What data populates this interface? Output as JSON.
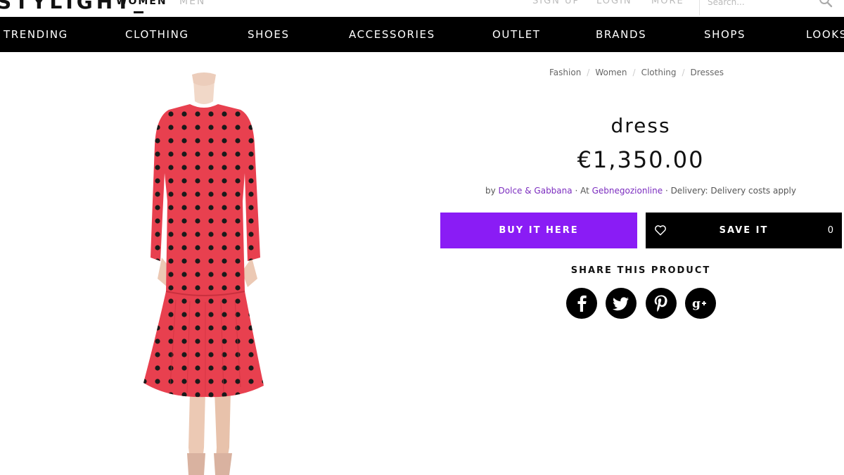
{
  "header": {
    "logo": "STYLIGHT",
    "gender_tabs": [
      "WOMEN",
      "MEN"
    ],
    "links": [
      "SIGN UP",
      "LOGIN",
      "MORE"
    ],
    "search_placeholder": "Search..."
  },
  "nav": {
    "items": [
      "TRENDING",
      "CLOTHING",
      "SHOES",
      "ACCESSORIES",
      "OUTLET",
      "BRANDS",
      "SHOPS",
      "LOOKS"
    ]
  },
  "breadcrumb": [
    "Fashion",
    "Women",
    "Clothing",
    "Dresses"
  ],
  "product": {
    "name": "dress",
    "price": "€1,350.00",
    "by_label": "by",
    "brand": "Dolce & Gabbana",
    "at_label": "· At",
    "shop": "Gebnegozionline",
    "delivery_label": "· Delivery:",
    "delivery_value": "Delivery costs apply",
    "dress_color": "#e8404f",
    "dot_color": "#1a1a1a"
  },
  "actions": {
    "buy_label": "BUY IT HERE",
    "save_label": "SAVE IT",
    "save_count": "0",
    "buy_color": "#8a1cf5"
  },
  "share": {
    "title": "SHARE THIS PRODUCT",
    "networks": [
      "facebook-icon",
      "twitter-icon",
      "pinterest-icon",
      "google-plus-icon"
    ]
  }
}
